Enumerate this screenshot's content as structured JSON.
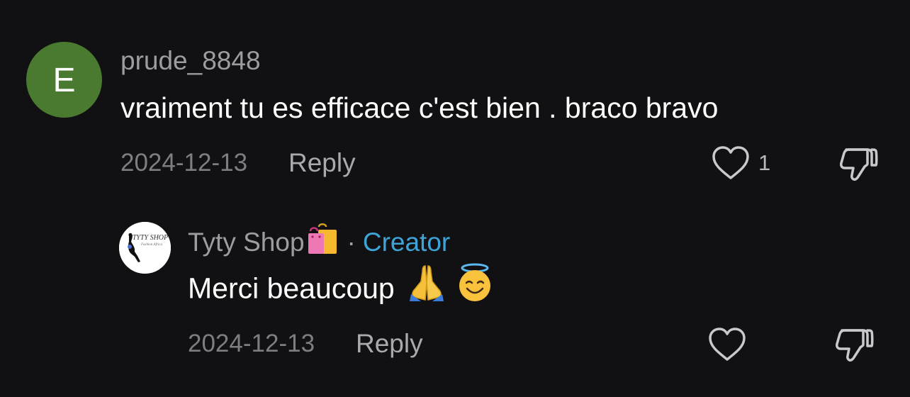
{
  "comment": {
    "avatar_letter": "E",
    "avatar_color": "#4a7a30",
    "username": "prude_8848",
    "text": "vraiment tu es efficace c'est bien . braco bravo",
    "date": "2024-12-13",
    "reply_label": "Reply",
    "like_count": "1"
  },
  "reply": {
    "avatar_text": "TYTY SHOP",
    "avatar_subtext": "Fashion Africa",
    "username": "Tyty Shop",
    "username_emoji": "shopping-bags",
    "separator": "·",
    "badge": "Creator",
    "badge_color": "#3ea4d8",
    "text": "Merci beaucoup",
    "text_emojis": [
      "folded-hands",
      "smiling-face-with-halo"
    ],
    "date": "2024-12-13",
    "reply_label": "Reply"
  },
  "icons": {
    "like": "heart-outline-icon",
    "dislike": "thumbs-down-outline-icon"
  }
}
